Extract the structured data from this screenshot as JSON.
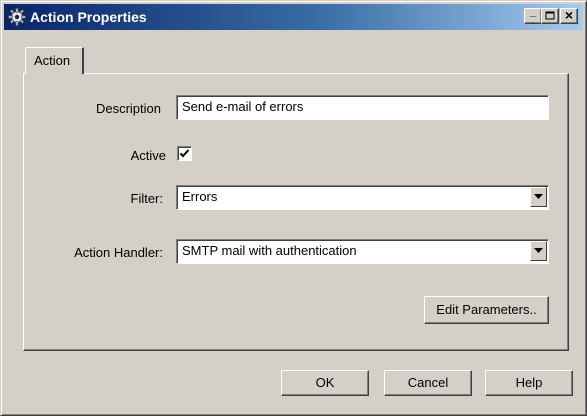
{
  "window": {
    "title": "Action Properties",
    "minimize_label": "_",
    "close_label": "×"
  },
  "tabs": [
    {
      "label": "Action",
      "selected": true
    }
  ],
  "form": {
    "description": {
      "label": "Description",
      "value": "Send e-mail of errors"
    },
    "active": {
      "label": "Active",
      "checked": true
    },
    "filter": {
      "label": "Filter:",
      "value": "Errors"
    },
    "action_handler": {
      "label": "Action Handler:",
      "value": "SMTP mail with authentication"
    },
    "edit_parameters_label": "Edit Parameters.."
  },
  "buttons": {
    "ok": "OK",
    "cancel": "Cancel",
    "help": "Help"
  },
  "icons": {
    "title": "gear-icon",
    "dropdown": "chevron-down-icon",
    "check": "checkmark-icon"
  },
  "colors": {
    "titlebar_start": "#0a246a",
    "titlebar_end": "#a6caf0",
    "face": "#d4d0c8"
  }
}
